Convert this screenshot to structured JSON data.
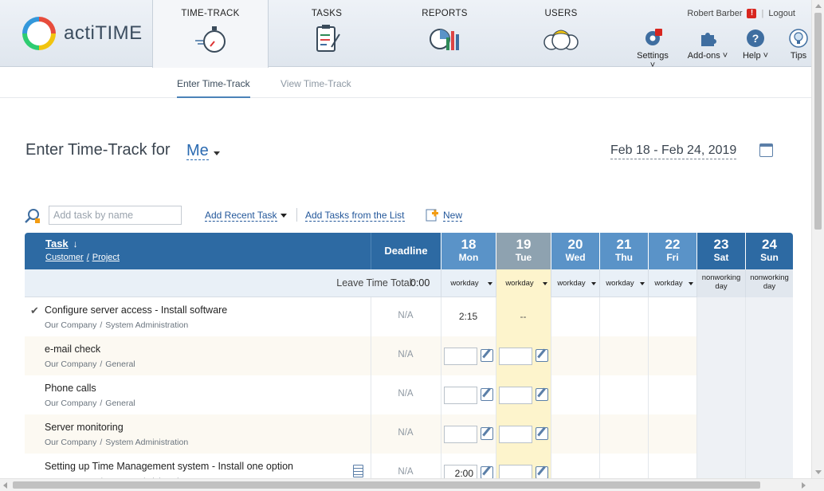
{
  "app": {
    "name": "actiTIME"
  },
  "nav": {
    "tabs": [
      {
        "label": "TIME-TRACK",
        "icon": "stopwatch-icon",
        "active": true
      },
      {
        "label": "TASKS",
        "icon": "clipboard-icon"
      },
      {
        "label": "REPORTS",
        "icon": "bar-chart-icon"
      },
      {
        "label": "USERS",
        "icon": "users-icon"
      }
    ],
    "user_name": "Robert Barber",
    "logout": "Logout",
    "tools": [
      {
        "label": "Settings",
        "icon": "gear-icon"
      },
      {
        "label": "Add-ons",
        "icon": "puzzle-icon"
      },
      {
        "label": "Help",
        "icon": "help-icon"
      },
      {
        "label": "Tips",
        "icon": "lightbulb-icon"
      }
    ]
  },
  "subnav": {
    "enter": "Enter Time-Track",
    "view": "View Time-Track"
  },
  "page": {
    "title": "Enter Time-Track for",
    "user": "Me",
    "date_range": "Feb 18 - Feb 24, 2019"
  },
  "toolbar": {
    "search_placeholder": "Add task by name",
    "add_recent": "Add Recent Task",
    "add_list": "Add Tasks from the List",
    "new": "New"
  },
  "grid": {
    "header_task": "Task",
    "header_customer": "Customer",
    "header_sep": "/",
    "header_project": "Project",
    "header_deadline": "Deadline",
    "days": [
      {
        "num": "18",
        "name": "Mon",
        "type": "workday"
      },
      {
        "num": "19",
        "name": "Tue",
        "type": "workday",
        "selected": true
      },
      {
        "num": "20",
        "name": "Wed",
        "type": "workday"
      },
      {
        "num": "21",
        "name": "Thu",
        "type": "workday"
      },
      {
        "num": "22",
        "name": "Fri",
        "type": "workday"
      },
      {
        "num": "23",
        "name": "Sat",
        "type": "nonworking day"
      },
      {
        "num": "24",
        "name": "Sun",
        "type": "nonworking day"
      }
    ],
    "leave_label": "Leave Time Total:",
    "leave_total": "0:00",
    "rows": [
      {
        "name": "Configure server access - Install software",
        "customer": "Our Company",
        "project": "System Administration",
        "deadline": "N/A",
        "mon": "2:15",
        "tue": "--",
        "checked": true,
        "inputs": false
      },
      {
        "name": "e-mail check",
        "customer": "Our Company",
        "project": "General",
        "deadline": "N/A",
        "mon": "",
        "tue": "",
        "inputs": true
      },
      {
        "name": "Phone calls",
        "customer": "Our Company",
        "project": "General",
        "deadline": "N/A",
        "mon": "",
        "tue": "",
        "inputs": true
      },
      {
        "name": "Server monitoring",
        "customer": "Our Company",
        "project": "System Administration",
        "deadline": "N/A",
        "mon": "",
        "tue": "",
        "inputs": true
      },
      {
        "name": "Setting up Time Management system - Install one option",
        "customer": "Our Company",
        "project": "System Administration",
        "deadline": "N/A",
        "mon": "2:00",
        "tue": "",
        "inputs": true,
        "note": true
      }
    ]
  },
  "colors": {
    "header": "#2d6aa3",
    "workday_header": "#5a93c8",
    "selected_header": "#8ea2b0",
    "selected_col": "#fdf4cc",
    "alt_row": "#fcf9f2"
  }
}
